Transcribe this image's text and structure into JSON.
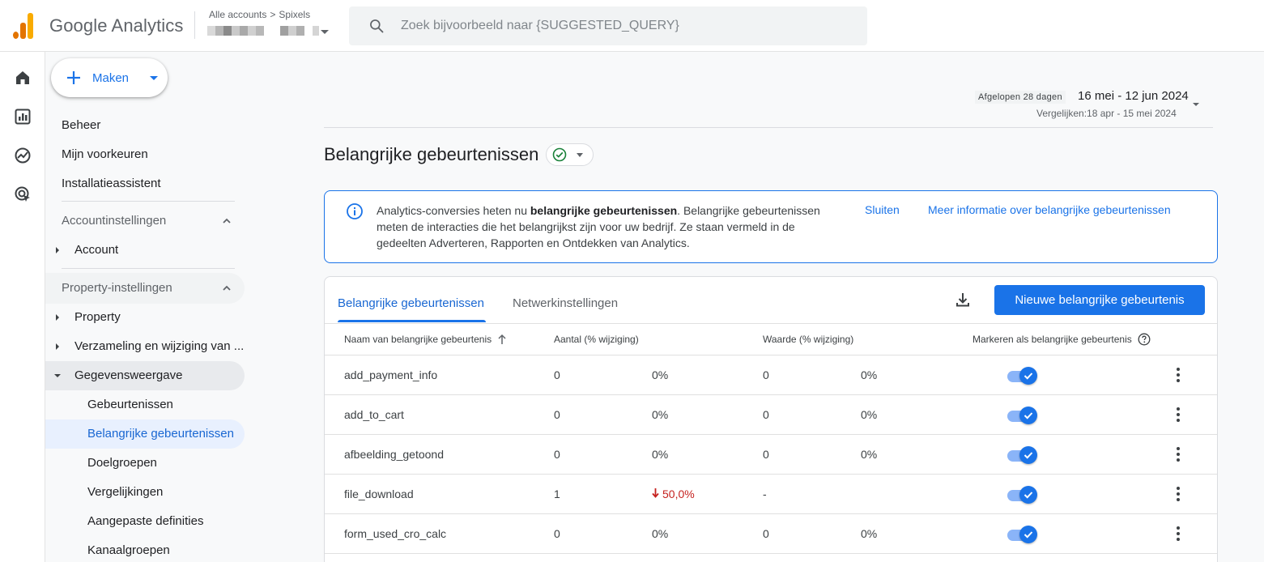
{
  "header": {
    "app_name": "Google Analytics",
    "breadcrumb": {
      "root": "Alle accounts",
      "separator": ">",
      "account": "Spixels"
    },
    "search_placeholder": "Zoek bijvoorbeeld naar {SUGGESTED_QUERY}",
    "logo_colors": [
      "#f9ab00",
      "#e37400"
    ]
  },
  "rail": {
    "icons": [
      "home-icon",
      "reports-icon",
      "explore-icon",
      "advertising-icon"
    ]
  },
  "sidebar": {
    "create_label": "Maken",
    "top_items": [
      "Beheer",
      "Mijn voorkeuren",
      "Installatieassistent"
    ],
    "account_section": {
      "title": "Accountinstellingen",
      "items": [
        "Account"
      ]
    },
    "property_section": {
      "title": "Property-instellingen",
      "items": [
        "Property",
        "Verzameling en wijziging van ...",
        "Gegevensweergave"
      ],
      "expanded_item": "Gegevensweergave",
      "sub_items": [
        "Gebeurtenissen",
        "Belangrijke gebeurtenissen",
        "Doelgroepen",
        "Vergelijkingen",
        "Aangepaste definities",
        "Kanaalgroepen"
      ],
      "active_sub_item": "Belangrijke gebeurtenissen"
    }
  },
  "date": {
    "chip": "Afgelopen 28 dagen",
    "range": "16 mei - 12 jun 2024",
    "compare": "Vergelijken:18 apr - 15 mei 2024"
  },
  "page": {
    "title": "Belangrijke gebeurtenissen"
  },
  "banner": {
    "text_prefix": "Analytics-conversies heten nu ",
    "text_bold": "belangrijke gebeurtenissen",
    "text_suffix": ". Belangrijke gebeurtenissen meten de interacties die het belangrijkst zijn voor uw bedrijf. Ze staan vermeld in de gedeelten Adverteren, Rapporten en Ontdekken van Analytics.",
    "close_label": "Sluiten",
    "more_label": "Meer informatie over belangrijke gebeurtenissen"
  },
  "card": {
    "tabs": [
      "Belangrijke gebeurtenissen",
      "Netwerkinstellingen"
    ],
    "active_tab": "Belangrijke gebeurtenissen",
    "new_button": "Nieuwe belangrijke gebeurtenis",
    "columns": [
      "Naam van belangrijke gebeurtenis",
      "Aantal (% wijziging)",
      "Waarde (% wijziging)",
      "Markeren als belangrijke gebeurtenis"
    ],
    "rows": [
      {
        "name": "add_payment_info",
        "count": "0",
        "count_change": "0%",
        "value": "0",
        "value_change": "0%",
        "marked": true,
        "trend": "none"
      },
      {
        "name": "add_to_cart",
        "count": "0",
        "count_change": "0%",
        "value": "0",
        "value_change": "0%",
        "marked": true,
        "trend": "none"
      },
      {
        "name": "afbeelding_getoond",
        "count": "0",
        "count_change": "0%",
        "value": "0",
        "value_change": "0%",
        "marked": true,
        "trend": "none"
      },
      {
        "name": "file_download",
        "count": "1",
        "count_change": "50,0%",
        "value": "-",
        "value_change": "",
        "marked": true,
        "trend": "down"
      },
      {
        "name": "form_used_cro_calc",
        "count": "0",
        "count_change": "0%",
        "value": "0",
        "value_change": "0%",
        "marked": true,
        "trend": "none"
      }
    ]
  },
  "colors": {
    "accent": "#1a73e8",
    "negative": "#c5221f",
    "success": "#188038"
  }
}
